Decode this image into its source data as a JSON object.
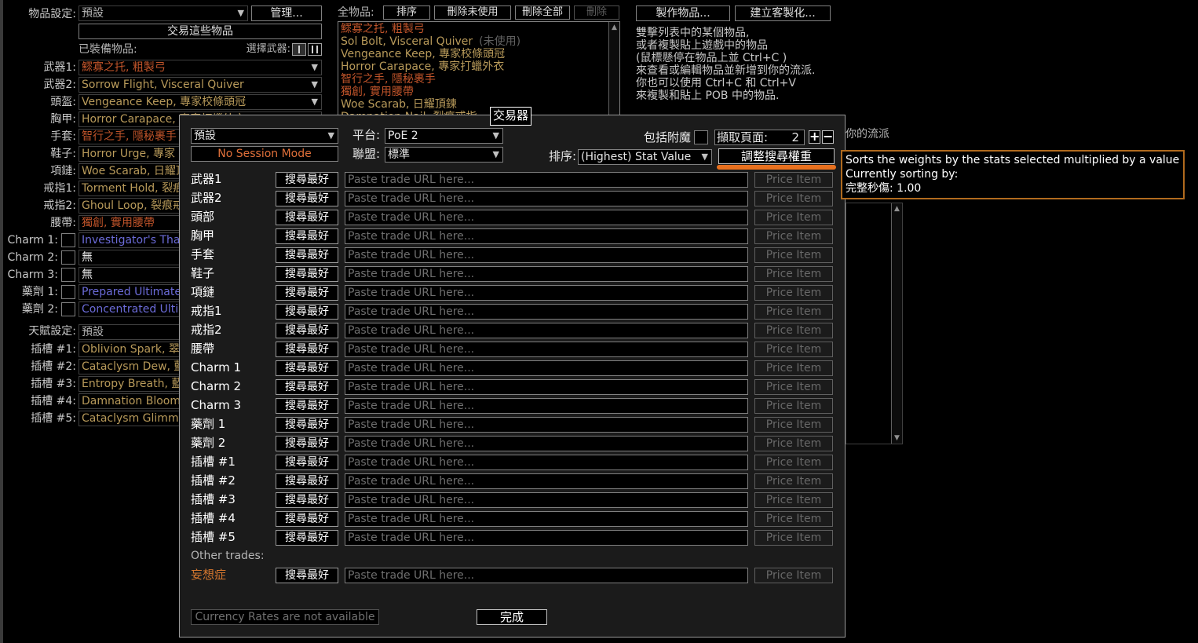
{
  "left": {
    "item_set_label": "物品設定:",
    "item_set_value": "預設",
    "manage_btn": "管理...",
    "trade_these_btn": "交易這些物品",
    "equipped_label": "已裝備物品:",
    "weapon_swap_label": "選擇武器:",
    "slots": [
      {
        "label": "武器1:",
        "value": "鰥寡之托, 粗製弓",
        "color": "orange"
      },
      {
        "label": "武器2:",
        "value": "Sorrow Flight, Visceral Quiver",
        "color": "gold"
      },
      {
        "label": "頭盔:",
        "value": "Vengeance Keep, 專家校條頭冠",
        "color": "gold"
      },
      {
        "label": "胸甲:",
        "value": "Horror Carapace, 專家打蠟外衣",
        "color": "gold"
      },
      {
        "label": "手套:",
        "value": "智行之手, 隱秘裹手",
        "color": "orange"
      },
      {
        "label": "鞋子:",
        "value": "Horror Urge, 專家",
        "color": "gold"
      },
      {
        "label": "項鏈:",
        "value": "Woe Scarab, 日耀頂鍊",
        "color": "gold"
      },
      {
        "label": "戒指1:",
        "value": "Torment Hold, 裂痕",
        "color": "gold"
      },
      {
        "label": "戒指2:",
        "value": "Ghoul Loop, 裂痕戒",
        "color": "gold"
      },
      {
        "label": "腰帶:",
        "value": "獨創, 實用腰帶",
        "color": "orange"
      }
    ],
    "charms": [
      {
        "label": "Charm 1:",
        "value": "Investigator's Tha",
        "color": "blue"
      },
      {
        "label": "Charm 2:",
        "value": "無",
        "color": "white"
      },
      {
        "label": "Charm 3:",
        "value": "無",
        "color": "white"
      }
    ],
    "flasks": [
      {
        "label": "藥劑 1:",
        "value": "Prepared Ultimate",
        "color": "blue"
      },
      {
        "label": "藥劑 2:",
        "value": "Concentrated Ulti",
        "color": "blue"
      }
    ],
    "tree_label": "天賦設定:",
    "tree_value": "預設",
    "sockets": [
      {
        "label": "插槽 #1:",
        "value": "Oblivion Spark, 翠",
        "color": "gold"
      },
      {
        "label": "插槽 #2:",
        "value": "Cataclysm Dew, 藍",
        "color": "gold"
      },
      {
        "label": "插槽 #3:",
        "value": "Entropy Breath, 藍",
        "color": "gold"
      },
      {
        "label": "插槽 #4:",
        "value": "Damnation Bloom",
        "color": "gold"
      },
      {
        "label": "插槽 #5:",
        "value": "Cataclysm Glimme",
        "color": "gold"
      }
    ]
  },
  "middle": {
    "all_items_label": "全物品:",
    "sort_btn": "排序",
    "delete_unused_btn": "刪除未使用",
    "delete_all_btn": "刪除全部",
    "delete_btn": "刪除",
    "items": [
      {
        "text": "鰥寡之托, 粗製弓",
        "color": "orange",
        "suffix": ""
      },
      {
        "text": "Sol Bolt, Visceral Quiver",
        "color": "gold",
        "suffix": "(未使用)"
      },
      {
        "text": "Vengeance Keep, 專家校條頭冠",
        "color": "gold",
        "suffix": ""
      },
      {
        "text": "Horror Carapace, 專家打蠟外衣",
        "color": "gold",
        "suffix": ""
      },
      {
        "text": "智行之手, 隱秘裹手",
        "color": "orange",
        "suffix": ""
      },
      {
        "text": "獨創, 實用腰帶",
        "color": "orange",
        "suffix": ""
      },
      {
        "text": "Woe Scarab, 日耀頂鍊",
        "color": "gold",
        "suffix": ""
      },
      {
        "text": "Damnation Nail, 裂痕戒指",
        "color": "gold",
        "suffix": ""
      }
    ]
  },
  "right": {
    "craft_btn": "製作物品...",
    "custom_btn": "建立客製化...",
    "help_lines": [
      "雙擊列表中的某個物品,",
      "或者複製貼上遊戲中的物品",
      "(鼠標懸停在物品上並 Ctrl+C )",
      "來查看或編輯物品並新增到你的流派.",
      "你也可以使用 Ctrl+C 和 Ctrl+V",
      "來複製和貼上 POB 中的物品."
    ],
    "partial_text": "你的流派"
  },
  "dialog": {
    "title": "交易器",
    "preset_value": "預設",
    "platform_label": "平台:",
    "platform_value": "PoE 2",
    "include_ench_label": "包括附魔",
    "fetch_pages_label": "擷取頁面:",
    "fetch_pages_value": "2",
    "plus_label": "+",
    "minus_label": "−",
    "session_btn": "No Session Mode",
    "league_label": "聯盟:",
    "league_value": "標準",
    "sort_label": "排序:",
    "sort_value": "(Highest) Stat Value",
    "adjust_weights_btn": "調整搜尋權重",
    "search_btn": "搜尋最好",
    "url_placeholder": "Paste trade URL here...",
    "price_btn": "Price Item",
    "rows": [
      {
        "label": "武器1"
      },
      {
        "label": "武器2"
      },
      {
        "label": "頭部"
      },
      {
        "label": "胸甲"
      },
      {
        "label": "手套"
      },
      {
        "label": "鞋子"
      },
      {
        "label": "項鏈"
      },
      {
        "label": "戒指1"
      },
      {
        "label": "戒指2"
      },
      {
        "label": "腰帶"
      },
      {
        "label": "Charm 1"
      },
      {
        "label": "Charm 2"
      },
      {
        "label": "Charm 3"
      },
      {
        "label": "藥劑 1"
      },
      {
        "label": "藥劑 2"
      },
      {
        "label": "插槽 #1"
      },
      {
        "label": "插槽 #2"
      },
      {
        "label": "插槽 #3"
      },
      {
        "label": "插槽 #4"
      },
      {
        "label": "插槽 #5"
      }
    ],
    "other_trades_label": "Other trades:",
    "other_row_label": "妄想症",
    "currency_btn": "Currency Rates are not available",
    "done_btn": "完成"
  },
  "tooltip": {
    "line1": "Sorts the weights by the stats selected multiplied by a value",
    "line2": "Currently sorting by:",
    "line3": "完整秒傷: 1.00"
  },
  "colors": {
    "gold": "#b89a5a",
    "orange": "#c0542a",
    "blue": "#6b6bd8",
    "accent_underline": "#e8701e",
    "tooltip_border": "#b06a1e"
  }
}
